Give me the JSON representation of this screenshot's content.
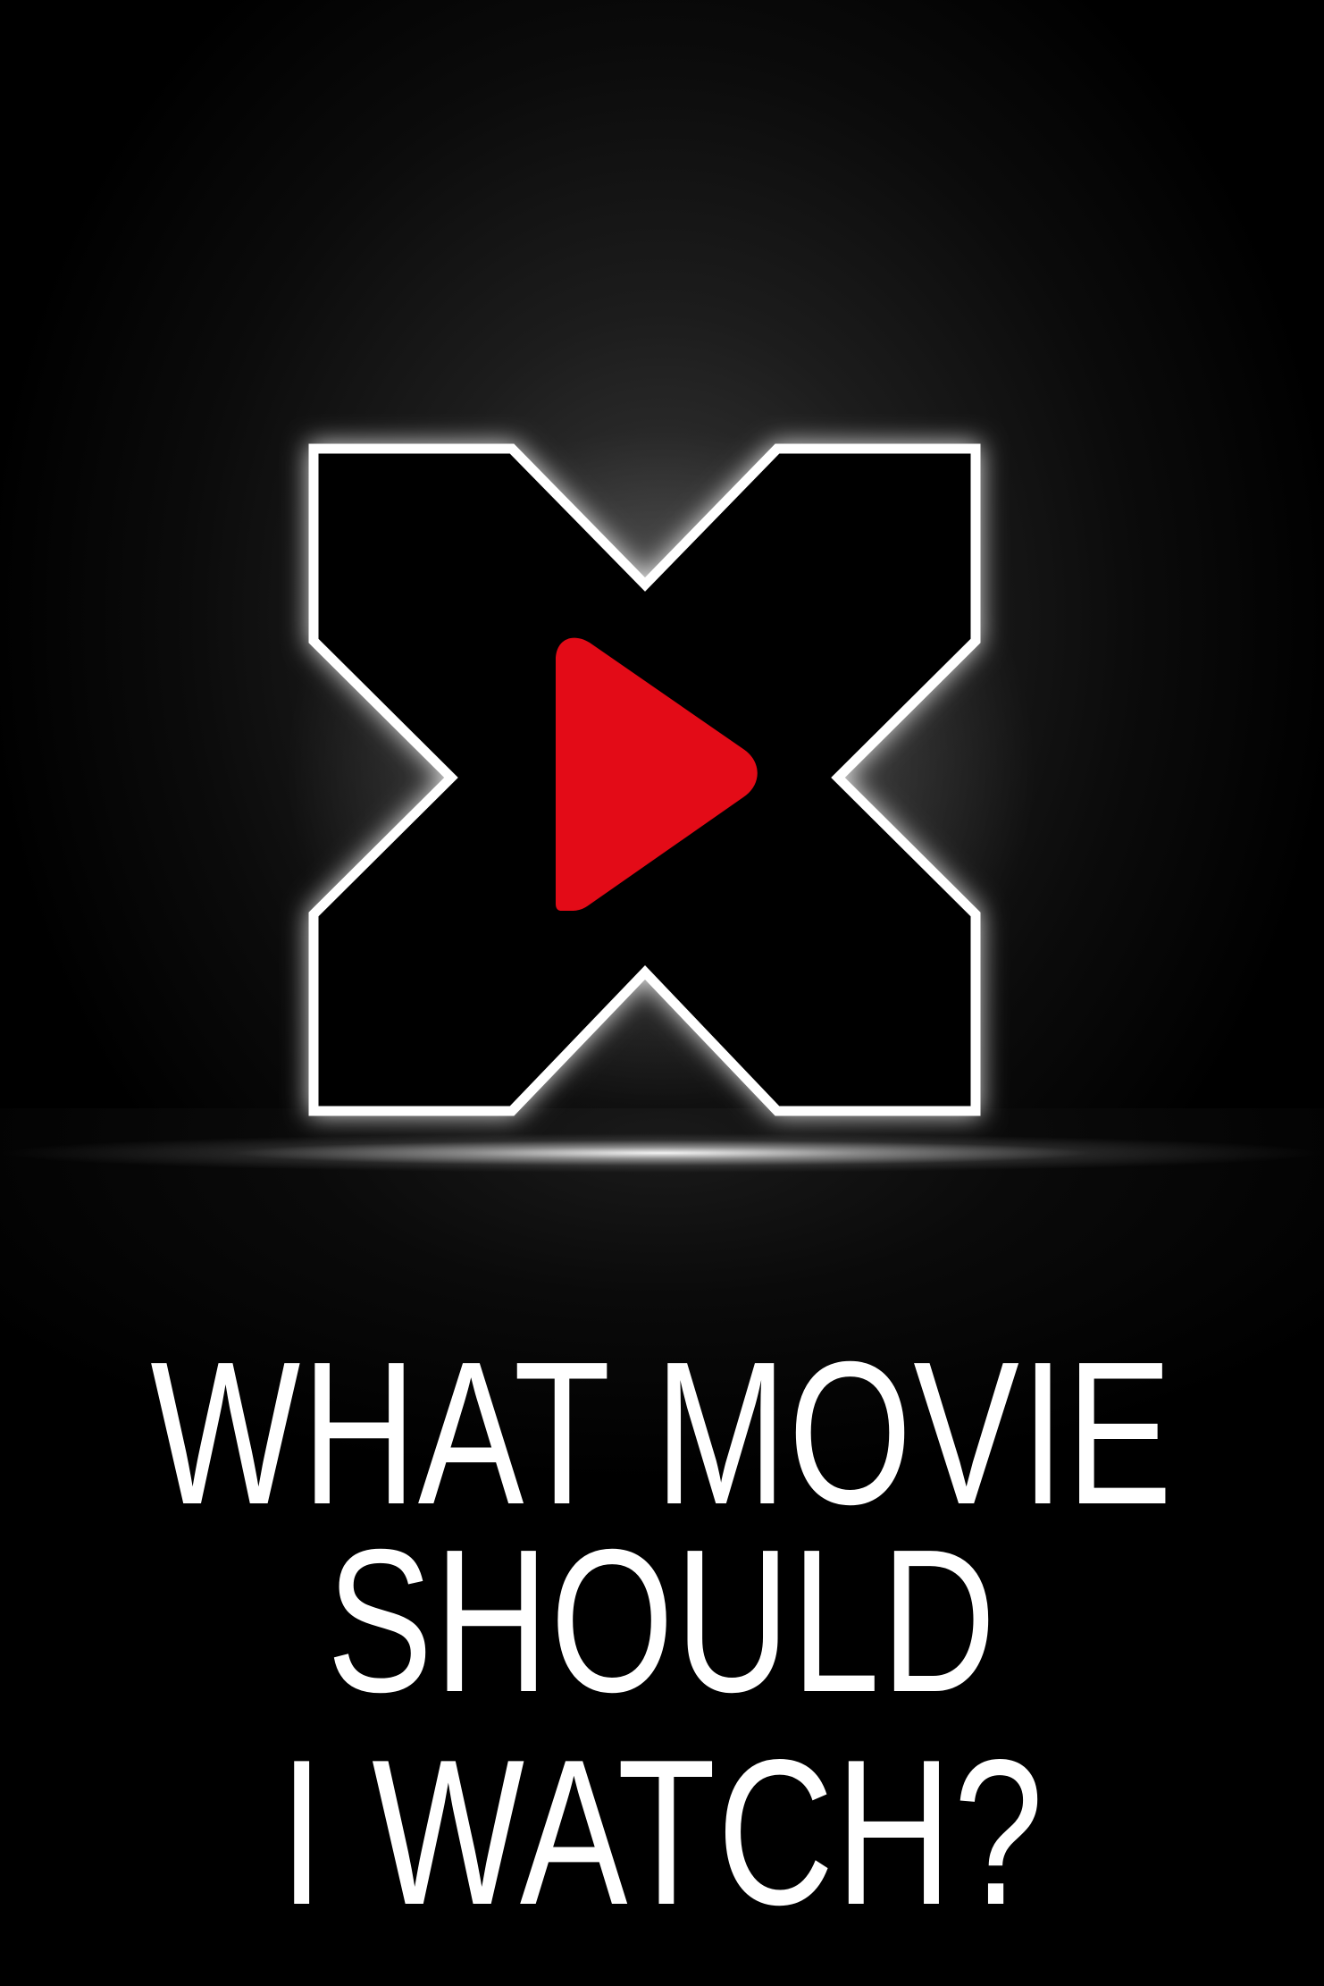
{
  "headline": {
    "line1": "WHAT MOVIE",
    "line2": "SHOULD",
    "line3": "I WATCH?"
  },
  "logo": {
    "icon": "x-play-logo",
    "outline_color": "#ffffff",
    "fill_color": "#000000",
    "play_color": "#e30b17"
  },
  "background_color": "#000000"
}
